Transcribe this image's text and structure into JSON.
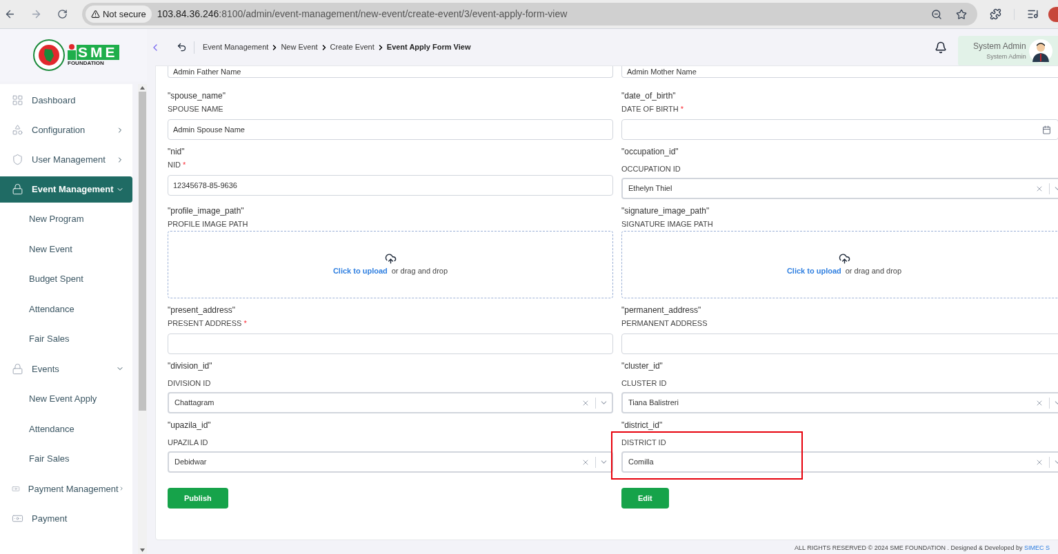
{
  "browser": {
    "security": "Not secure",
    "url_host": "103.84.36.246",
    "url_rest": ":8100/admin/event-management/new-event/create-event/3/event-apply-form-view"
  },
  "logo": {
    "mark": "SME",
    "caption": "FOUNDATION"
  },
  "sidebar": {
    "items": [
      {
        "label": "Dashboard",
        "kind": "link",
        "selected": false
      },
      {
        "label": "Configuration",
        "kind": "group",
        "expanded": false,
        "selected": false
      },
      {
        "label": "User Management",
        "kind": "group",
        "expanded": false,
        "selected": false
      },
      {
        "label": "Event Management",
        "kind": "group",
        "expanded": true,
        "selected": true,
        "children": [
          {
            "label": "New Program",
            "selected": false
          },
          {
            "label": "New Event",
            "selected": false
          },
          {
            "label": "Budget Spent",
            "selected": false
          },
          {
            "label": "Attendance",
            "selected": false
          },
          {
            "label": "Fair Sales",
            "selected": false
          }
        ]
      },
      {
        "label": "Events",
        "kind": "group",
        "expanded": true,
        "selected": false,
        "children": [
          {
            "label": "New Event Apply",
            "selected": false
          },
          {
            "label": "Attendance",
            "selected": false
          },
          {
            "label": "Fair Sales",
            "selected": false
          }
        ]
      },
      {
        "label": "Payment Management",
        "kind": "group",
        "expanded": false,
        "selected": false
      },
      {
        "label": "Payment",
        "kind": "link",
        "selected": false
      }
    ]
  },
  "header": {
    "breadcrumb": [
      "Event Management",
      "New Event",
      "Create Event",
      "Event Apply Form View"
    ],
    "user_name": "System Admin",
    "user_role": "System Admin"
  },
  "form": {
    "required_mark": "*",
    "top_values": [
      "Admin Father Name",
      "Admin Mother Name"
    ],
    "rows": [
      [
        {
          "key": "\"spouse_name\"",
          "label": "SPOUSE NAME",
          "required": false,
          "kind": "input",
          "value": "Admin Spouse Name"
        },
        {
          "key": "\"date_of_birth\"",
          "label": "DATE OF BIRTH",
          "required": true,
          "kind": "date"
        }
      ],
      [
        {
          "key": "\"nid\"",
          "label": "NID",
          "required": true,
          "kind": "input",
          "value": "12345678-85-9636"
        },
        {
          "key": "\"occupation_id\"",
          "label": "OCCUPATION ID",
          "required": false,
          "kind": "select",
          "value": "Ethelyn Thiel"
        }
      ],
      [
        {
          "key": "\"profile_image_path\"",
          "label": "PROFILE IMAGE PATH",
          "required": false,
          "kind": "upload",
          "link": "Click to upload",
          "text": "or drag and drop"
        },
        {
          "key": "\"signature_image_path\"",
          "label": "SIGNATURE IMAGE PATH",
          "required": false,
          "kind": "upload",
          "link": "Click to upload",
          "text": "or drag and drop"
        }
      ],
      [
        {
          "key": "\"present_address\"",
          "label": "PRESENT ADDRESS",
          "required": true,
          "kind": "input"
        },
        {
          "key": "\"permanent_address\"",
          "label": "PERMANENT ADDRESS",
          "required": false,
          "kind": "input"
        }
      ],
      [
        {
          "key": "\"division_id\"",
          "label": "DIVISION ID",
          "required": false,
          "kind": "select",
          "value": "Chattagram"
        },
        {
          "key": "\"cluster_id\"",
          "label": "CLUSTER ID",
          "required": false,
          "kind": "select",
          "value": "Tiana Balistreri"
        }
      ],
      [
        {
          "key": "\"upazila_id\"",
          "label": "UPAZILA ID",
          "required": false,
          "kind": "select",
          "value": "Debidwar"
        },
        {
          "key": "\"district_id\"",
          "label": "DISTRICT ID",
          "required": false,
          "kind": "select",
          "value": "Comilla",
          "highlighted": true
        }
      ]
    ],
    "buttons": [
      "Publish",
      "Edit"
    ]
  },
  "footer": {
    "text": "ALL RIGHTS RESERVED © 2024 SME FOUNDATION . Designed & Developed by",
    "link": "SIMEC S"
  }
}
